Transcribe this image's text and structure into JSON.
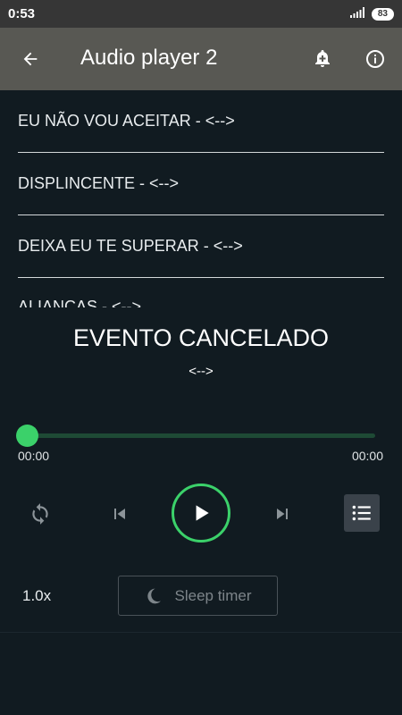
{
  "status_bar": {
    "time": "0:53",
    "battery": "83"
  },
  "app_bar": {
    "title": "Audio player 2"
  },
  "tracks": [
    {
      "title": "EU NÃO VOU ACEITAR - <-->"
    },
    {
      "title": "DISPLINCENTE - <-->"
    },
    {
      "title": "DEIXA EU TE SUPERAR - <-->"
    },
    {
      "title": "ALIANÇAS - <-->"
    }
  ],
  "now_playing": {
    "title": "EVENTO CANCELADO",
    "artist": "<-->",
    "position": "00:00",
    "duration": "00:00",
    "progress": 0
  },
  "controls": {
    "speed": "1.0x",
    "sleep_timer": "Sleep timer"
  },
  "colors": {
    "accent": "#3bd16a",
    "app_bar": "#585853",
    "background": "#111b21"
  },
  "icons": {
    "back": "arrow-back-icon",
    "bell": "bell-add-icon",
    "info": "info-icon",
    "repeat": "repeat-icon",
    "prev": "skip-previous-icon",
    "play": "play-icon",
    "next": "skip-next-icon",
    "queue": "queue-list-icon",
    "sleep": "moon-icon"
  }
}
